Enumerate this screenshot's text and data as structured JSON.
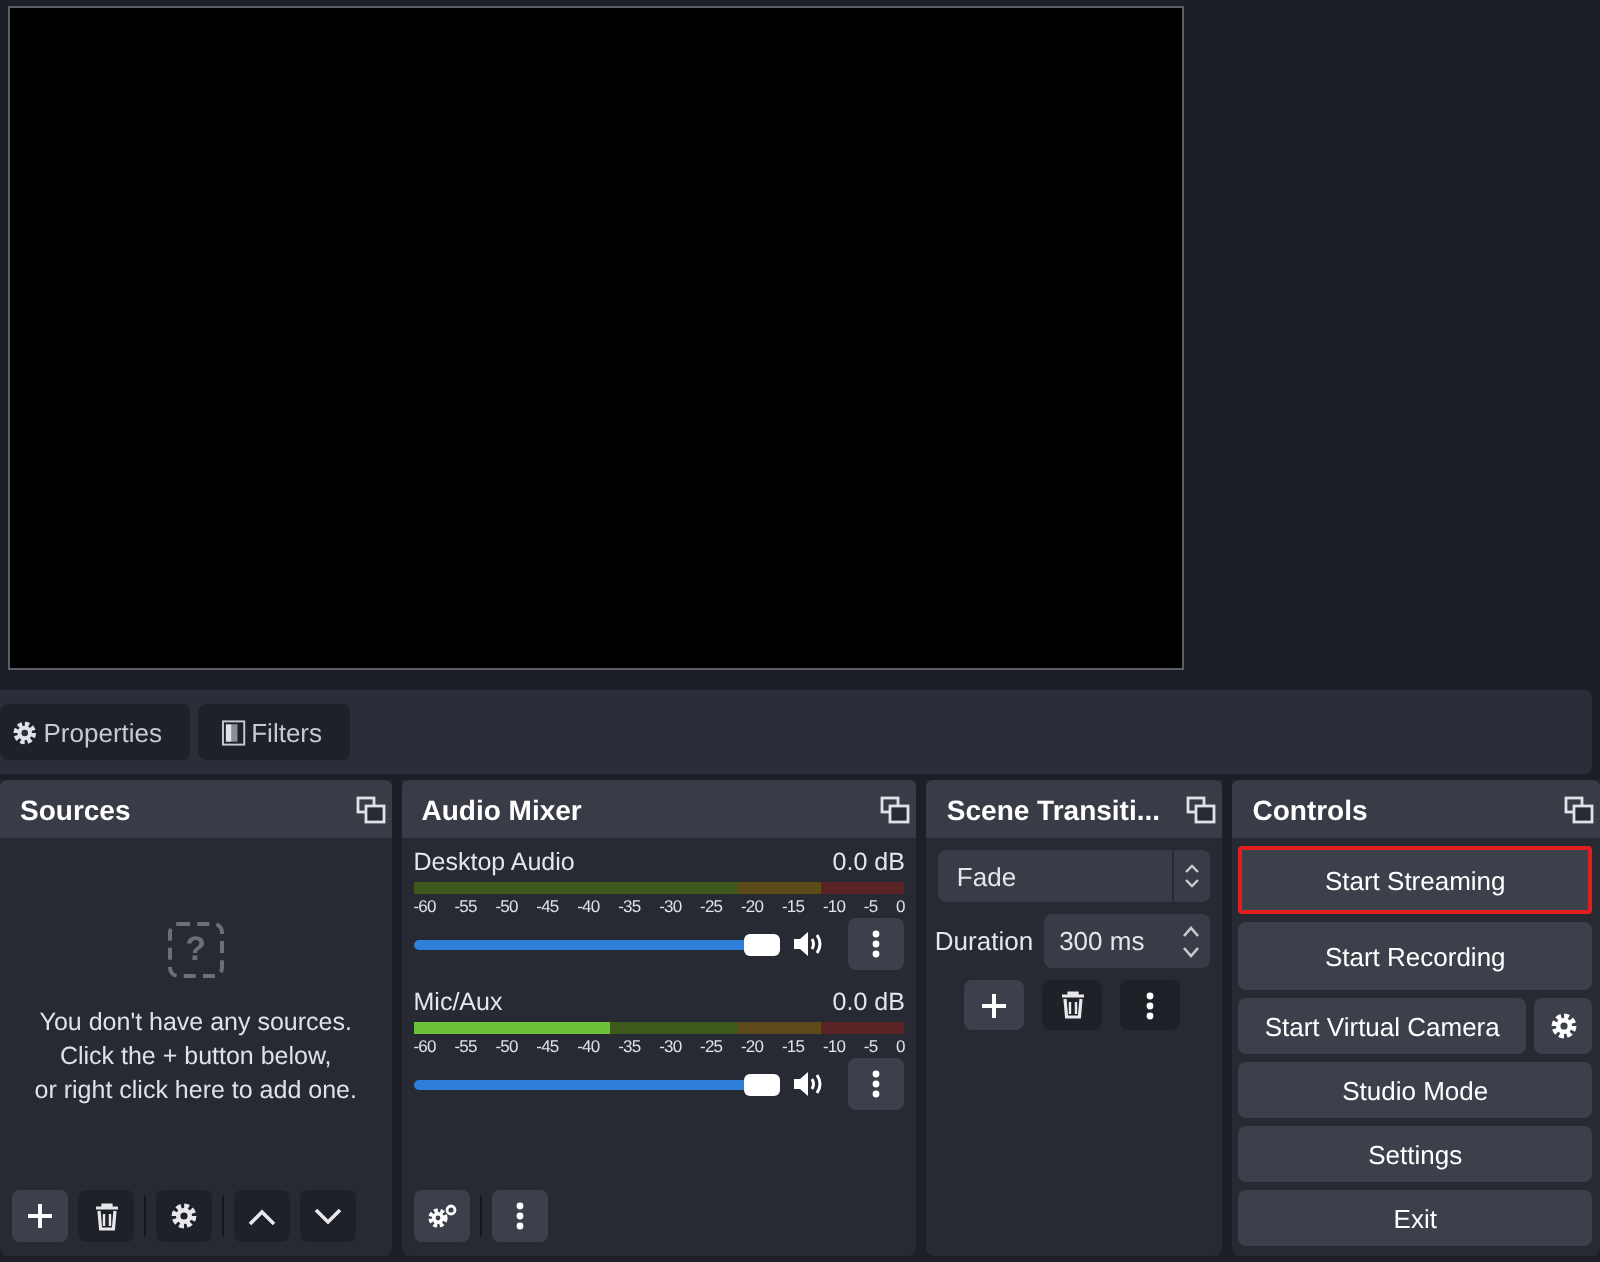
{
  "preview_toolbar": {
    "buttons": [
      {
        "kind": "properties",
        "label": "Properties"
      },
      {
        "kind": "filters",
        "label": "Filters"
      }
    ]
  },
  "sources": {
    "title": "Sources",
    "empty_icon": "?",
    "empty_message": [
      "You don't have any sources.",
      "Click the + button below,",
      "or right click here to add one."
    ]
  },
  "audio_mixer": {
    "title": "Audio Mixer",
    "channels": [
      {
        "name": "Desktop Audio",
        "reading": "0.0 dB",
        "muted": false,
        "volume": {
          "level": 1
        },
        "ticks": [
          "-60",
          "-55",
          "-50",
          "-45",
          "-40",
          "-35",
          "-30",
          "-25",
          "-20",
          "-15",
          "-10",
          "-5",
          "0"
        ]
      },
      {
        "name": "Mic/Aux",
        "reading": "0.0 dB",
        "muted": false,
        "meter": {
          "level": 0.4
        },
        "volume": {
          "level": 1
        },
        "ticks": [
          "-60",
          "-55",
          "-50",
          "-45",
          "-40",
          "-35",
          "-30",
          "-25",
          "-20",
          "-15",
          "-10",
          "-5",
          "0"
        ]
      }
    ]
  },
  "scene_transitions": {
    "title": "Scene Transiti...",
    "transition": "Fade",
    "duration_label": "Duration",
    "duration": "300 ms"
  },
  "controls": {
    "title": "Controls",
    "buttons": [
      {
        "label": "Start Streaming",
        "highlighted": true,
        "kind": "wide"
      },
      {
        "label": "Start Recording",
        "highlighted": false,
        "kind": "wide"
      },
      {
        "label": "Start Virtual Camera",
        "highlighted": false,
        "kind": "with-settings"
      },
      {
        "label": "Studio Mode",
        "highlighted": false,
        "kind": "wide"
      },
      {
        "label": "Settings",
        "highlighted": false,
        "kind": "wide"
      },
      {
        "label": "Exit",
        "highlighted": false,
        "kind": "wide"
      }
    ]
  }
}
